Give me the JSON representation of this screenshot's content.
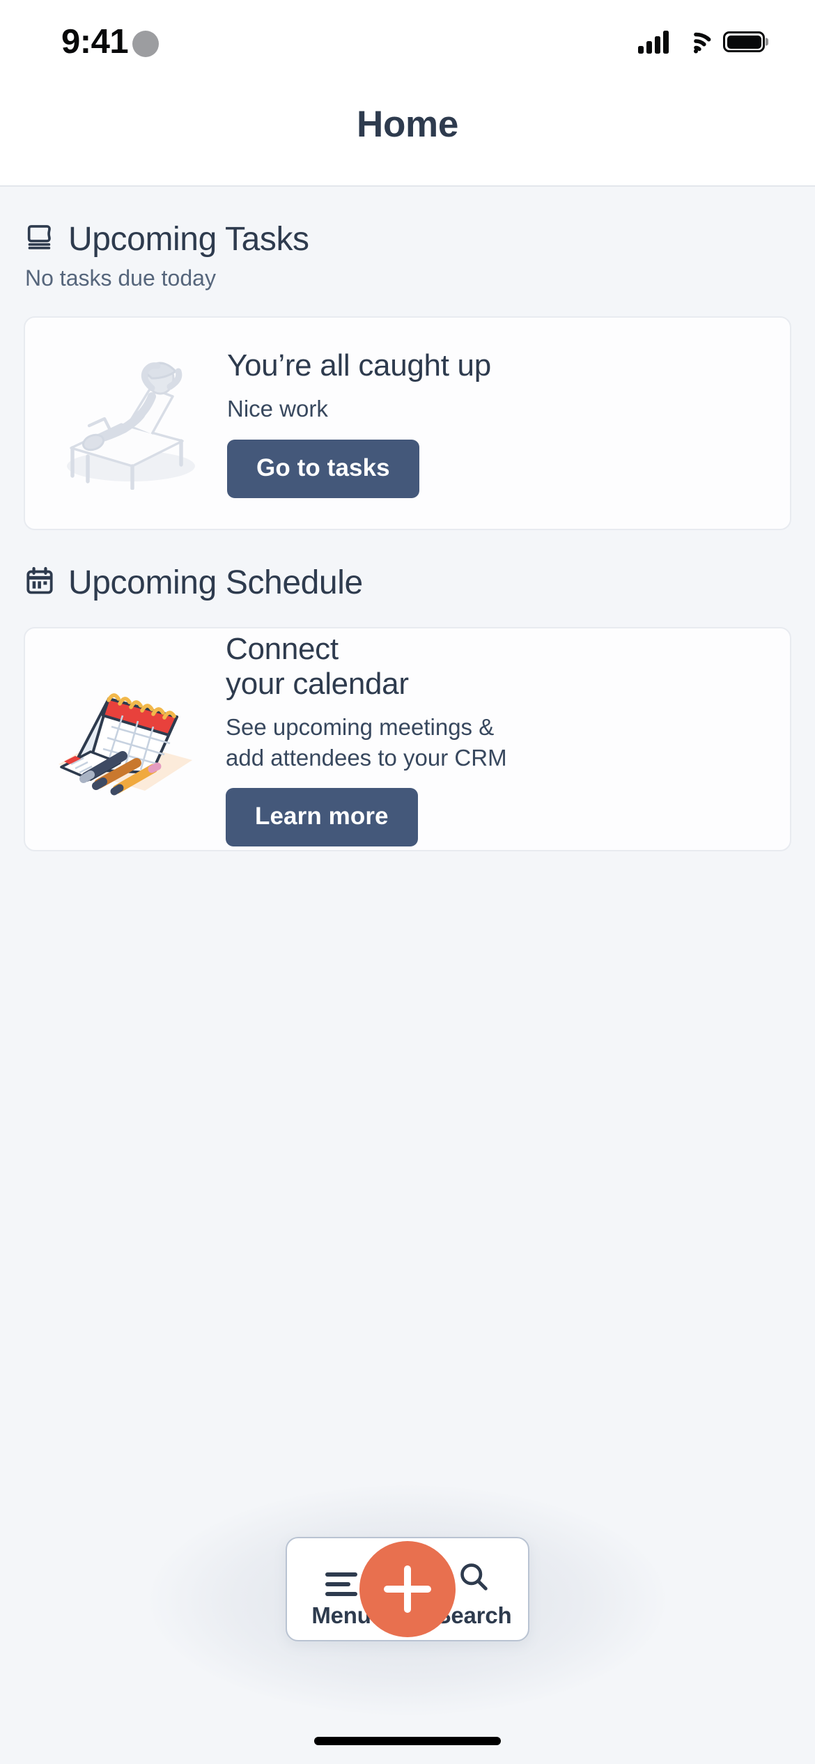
{
  "status_bar": {
    "time": "9:41",
    "cellular_icon": "signal-bars-icon",
    "wifi_icon": "wifi-icon",
    "battery_icon": "battery-full-icon"
  },
  "nav": {
    "title": "Home"
  },
  "sections": [
    {
      "id": "upcoming-tasks",
      "icon": "tasks-icon",
      "title": "Upcoming Tasks",
      "subtitle": "No tasks due today",
      "card": {
        "illustration": "person-relaxing-lounge-chair-illustration",
        "title": "You’re all caught up",
        "description": "Nice work",
        "button_label": "Go to tasks"
      }
    },
    {
      "id": "upcoming-schedule",
      "icon": "calendar-icon",
      "title": "Upcoming Schedule",
      "subtitle": "",
      "card": {
        "illustration": "desk-calendar-pens-illustration",
        "title_line1": "Connect",
        "title_line2": "your calendar",
        "description_line1": "See upcoming meetings &",
        "description_line2": "add attendees to your CRM",
        "button_label": "Learn more"
      }
    }
  ],
  "toolbar": {
    "menu_label": "Menu",
    "menu_icon": "hamburger-menu-icon",
    "search_label": "Search",
    "search_icon": "search-icon",
    "fab_icon": "plus-icon"
  },
  "colors": {
    "accent_orange": "#E8704F",
    "primary_button": "#44587A",
    "heading_text": "#2E3B4E",
    "page_background": "#F4F6F9",
    "card_background": "#FDFDFE",
    "card_border": "#E8EBF0"
  }
}
